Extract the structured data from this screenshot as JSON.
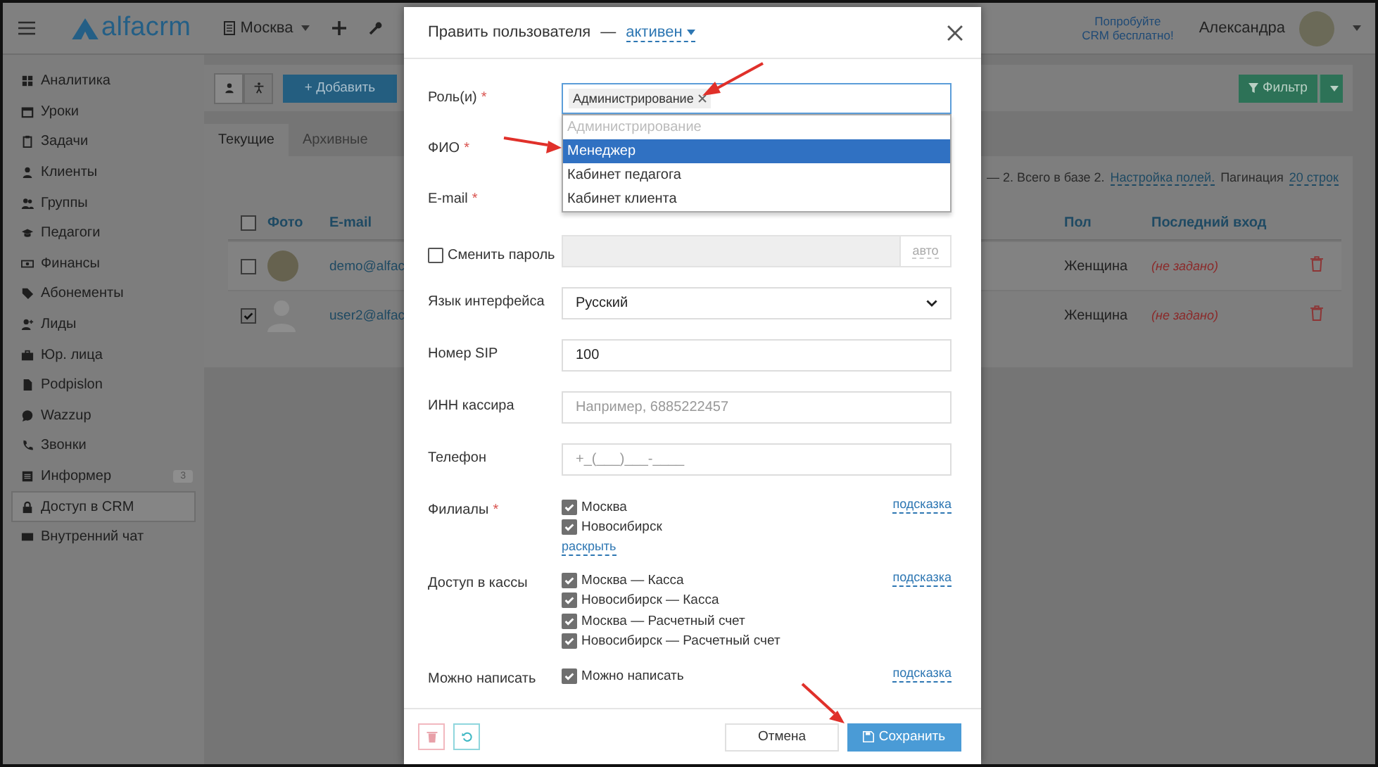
{
  "topbar": {
    "logo": "alfacrm",
    "branch": "Москва",
    "promo": [
      "Попробуйте",
      "CRM бесплатно!"
    ],
    "user": "Александра"
  },
  "sidebar": {
    "items": [
      {
        "label": "Аналитика",
        "selected": false
      },
      {
        "label": "Уроки",
        "selected": false
      },
      {
        "label": "Задачи",
        "selected": false
      },
      {
        "label": "Клиенты",
        "selected": false
      },
      {
        "label": "Группы",
        "selected": false
      },
      {
        "label": "Педагоги",
        "selected": false
      },
      {
        "label": "Финансы",
        "selected": false
      },
      {
        "label": "Абонементы",
        "selected": false
      },
      {
        "label": "Лиды",
        "selected": false
      },
      {
        "label": "Юр. лица",
        "selected": false
      },
      {
        "label": "Podpislon",
        "selected": false
      },
      {
        "label": "Wazzup",
        "selected": false
      },
      {
        "label": "Звонки",
        "selected": false
      },
      {
        "label": "Информер",
        "selected": false,
        "badge": "3"
      },
      {
        "label": "Доступ в CRM",
        "selected": true
      },
      {
        "label": "Внутренний чат",
        "selected": false
      }
    ]
  },
  "toolbar": {
    "add_button": "+ Добавить",
    "filter_button": "Фильтр"
  },
  "tabs": [
    {
      "label": "Текущие",
      "selected": true
    },
    {
      "label": "Архивные",
      "selected": false
    }
  ],
  "table": {
    "summary": "— 2. Всего в базе 2.",
    "fields_link": "Настройка полей.",
    "pagination_label": "Пагинация",
    "pagination_link": "20 строк",
    "all_checked": false,
    "columns": [
      "Фото",
      "E-mail",
      "Пол",
      "Последний вход"
    ],
    "rows": [
      {
        "checked": false,
        "kind": "photo",
        "email": "demo@alfac",
        "gender": "Женщина",
        "last_login": "(не задано)"
      },
      {
        "checked": true,
        "kind": "silhouette",
        "email": "user2@alfac",
        "gender": "Женщина",
        "last_login": "(не задано)"
      }
    ]
  },
  "modal": {
    "title": "Править пользователя",
    "separator": "—",
    "status": "активен",
    "fields": [
      {
        "kind": "roles",
        "label": "Роль(и)",
        "required_mark": "*",
        "tags": [
          "Администрирование"
        ],
        "options": [
          {
            "label": "Администрирование",
            "disabled": true,
            "selected": false
          },
          {
            "label": "Менеджер",
            "disabled": false,
            "selected": true
          },
          {
            "label": "Кабинет педагога",
            "disabled": false,
            "selected": false
          },
          {
            "label": "Кабинет клиента",
            "disabled": false,
            "selected": false
          }
        ]
      },
      {
        "kind": "covered",
        "label": "ФИО",
        "required_mark": "*"
      },
      {
        "kind": "covered",
        "label": "E-mail",
        "required_mark": "*"
      },
      {
        "kind": "password",
        "label": "Сменить пароль",
        "checked": false,
        "button": "авто"
      },
      {
        "kind": "select",
        "label": "Язык интерфейса",
        "value": "Русский"
      },
      {
        "kind": "input",
        "label": "Номер SIP",
        "value": "100"
      },
      {
        "kind": "input",
        "label": "ИНН кассира",
        "placeholder": "Например, 6885222457"
      },
      {
        "kind": "input",
        "label": "Телефон",
        "placeholder": "+_(___)___-____"
      },
      {
        "kind": "checklist",
        "label": "Филиалы",
        "required_mark": "*",
        "hint": "подсказка",
        "expand_link": "раскрыть",
        "items": [
          {
            "label": "Москва",
            "checked": true
          },
          {
            "label": "Новосибирск",
            "checked": true
          }
        ]
      },
      {
        "kind": "checklist",
        "label": "Доступ в кассы",
        "hint": "подсказка",
        "items": [
          {
            "label": "Москва — Касса",
            "checked": true
          },
          {
            "label": "Новосибирск — Касса",
            "checked": true
          },
          {
            "label": "Москва — Расчетный счет",
            "checked": true
          },
          {
            "label": "Новосибирск — Расчетный счет",
            "checked": true
          }
        ]
      },
      {
        "kind": "checklist",
        "label": "Можно написать",
        "hint": "подсказка",
        "items": [
          {
            "label": "Можно написать",
            "checked": true
          }
        ]
      }
    ],
    "cancel": "Отмена",
    "save": "Сохранить"
  }
}
